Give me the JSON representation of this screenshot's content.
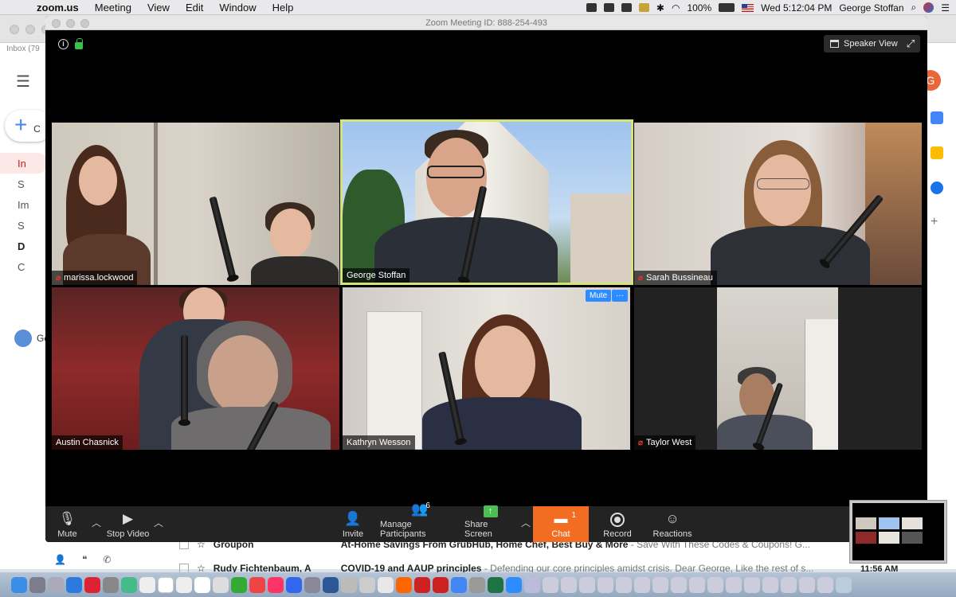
{
  "menubar": {
    "app": "zoom.us",
    "items": [
      "Meeting",
      "View",
      "Edit",
      "Window",
      "Help"
    ],
    "battery": "100%",
    "clock": "Wed 5:12:04 PM",
    "user": "George Stoffan"
  },
  "gmail": {
    "tab_label": "Inbox (79",
    "avatar_letter": "G",
    "compose_letter": "C",
    "nav_letters": [
      "In",
      "S",
      "Im",
      "S",
      "D",
      "C"
    ],
    "user_label": "Ge",
    "rows": [
      {
        "sender": "Groupon",
        "subject": "At-Home Savings From GrubHub, Home Chef, Best Buy & More",
        "preview": " - Save With These Codes & Coupons! G..."
      },
      {
        "sender": "Rudy Fichtenbaum, A",
        "subject": "COVID-19 and AAUP principles",
        "preview": " - Defending our core principles amidst crisis. Dear George, Like the rest of s..."
      }
    ],
    "time": "11:56 AM"
  },
  "zoom": {
    "window_title": "Zoom Meeting ID: 888-254-493",
    "speaker_view_label": "Speaker View",
    "participants": [
      {
        "name": "marissa.lockwood",
        "muted": true
      },
      {
        "name": "George Stoffan",
        "muted": false,
        "active": true
      },
      {
        "name": "Sarah Bussineau",
        "muted": true
      },
      {
        "name": "Austin Chasnick",
        "muted": false
      },
      {
        "name": "Kathryn Wesson",
        "muted": false
      },
      {
        "name": "Taylor West",
        "muted": true
      }
    ],
    "hover_mute_label": "Mute",
    "hover_more_label": "···",
    "toolbar": {
      "mute": "Mute",
      "stop_video": "Stop Video",
      "invite": "Invite",
      "manage_participants": "Manage Participants",
      "participant_count": "6",
      "share_screen": "Share Screen",
      "chat": "Chat",
      "chat_badge": "1",
      "record": "Record",
      "reactions": "Reactions"
    },
    "accent": "#f26d21",
    "active_speaker_border": "#d6e37a"
  }
}
